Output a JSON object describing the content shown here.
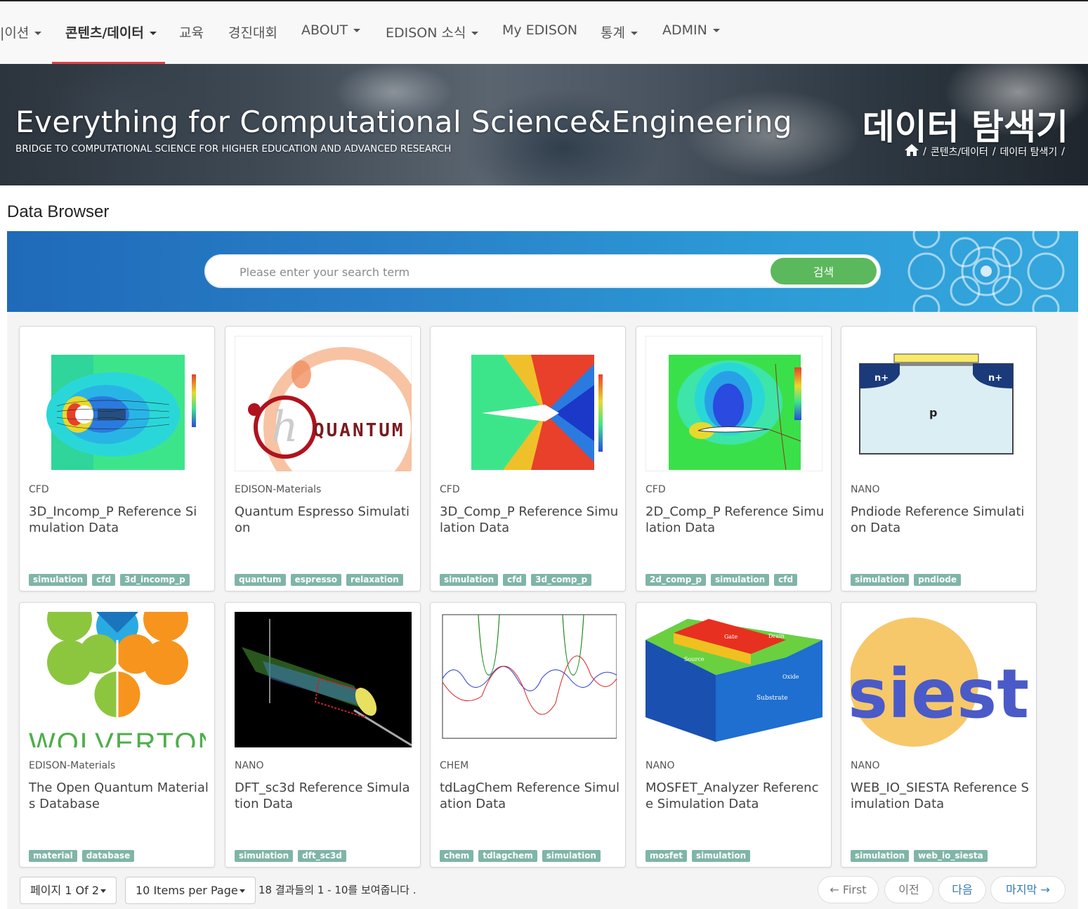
{
  "nav": {
    "items": [
      {
        "label": "|이션",
        "caret": true
      },
      {
        "label": "콘텐츠/데이터",
        "caret": true
      },
      {
        "label": "교육",
        "caret": false
      },
      {
        "label": "경진대회",
        "caret": false
      },
      {
        "label": "ABOUT",
        "caret": true
      },
      {
        "label": "EDISON 소식",
        "caret": true
      },
      {
        "label": "My EDISON",
        "caret": false
      },
      {
        "label": "통계",
        "caret": true
      },
      {
        "label": "ADMIN",
        "caret": true
      }
    ],
    "active_index": 1
  },
  "banner": {
    "title": "Everything for Computational Science&Engineering",
    "subtitle": "BRIDGE TO COMPUTATIONAL SCIENCE FOR HIGHER EDUCATION AND ADVANCED RESEARCH",
    "page_title": "데이터 탐색기",
    "breadcrumb": [
      "/",
      "콘텐츠/데이터",
      "/",
      "데이터 탐색기",
      "/"
    ]
  },
  "section_title": "Data Browser",
  "search": {
    "placeholder": "Please enter your search term",
    "button_label": "검색"
  },
  "cards": [
    {
      "category": "CFD",
      "title": "3D_Incomp_P Reference Simulation Data",
      "tags": [
        "simulation",
        "cfd",
        "3d_incomp_p"
      ],
      "thumb": "cfd-incompressible-cylinder-contour"
    },
    {
      "category": "EDISON-Materials",
      "title": "Quantum Espresso Simulation",
      "tags": [
        "quantum",
        "espresso",
        "relaxation"
      ],
      "thumb": "quantum-espresso-logo"
    },
    {
      "category": "CFD",
      "title": "3D_Comp_P Reference Simulation Data",
      "tags": [
        "simulation",
        "cfd",
        "3d_comp_p"
      ],
      "thumb": "cfd-compressible-wedge-contour"
    },
    {
      "category": "CFD",
      "title": "2D_Comp_P Reference Simulation Data",
      "tags": [
        "2d_comp_p",
        "simulation",
        "cfd"
      ],
      "thumb": "cfd-airfoil-contour"
    },
    {
      "category": "NANO",
      "title": "Pndiode Reference Simulation Data",
      "tags": [
        "simulation",
        "pndiode"
      ],
      "thumb": "pn-diode-diagram"
    },
    {
      "category": "EDISON-Materials",
      "title": "The Open Quantum Materials Database",
      "tags": [
        "material",
        "database"
      ],
      "thumb": "wolverton-logo"
    },
    {
      "category": "NANO",
      "title": "DFT_sc3d Reference Simulation Data",
      "tags": [
        "simulation",
        "dft_sc3d"
      ],
      "thumb": "nanotube-render"
    },
    {
      "category": "CHEM",
      "title": "tdLagChem Reference Simulation Data",
      "tags": [
        "chem",
        "tdlagchem",
        "simulation"
      ],
      "thumb": "wavefunction-plot"
    },
    {
      "category": "NANO",
      "title": "MOSFET_Analyzer Reference Simulation Data",
      "tags": [
        "mosfet",
        "simulation"
      ],
      "thumb": "mosfet-3d-diagram"
    },
    {
      "category": "NANO",
      "title": "WEB_IO_SIESTA Reference Simulation Data",
      "tags": [
        "simulation",
        "web_io_siesta"
      ],
      "thumb": "siesta-logo"
    }
  ],
  "thumb_text": {
    "quantum": "QUANTUM",
    "wolverton": "WOLVERTON",
    "siesta": "siesta",
    "pn_nplus": "n+",
    "pn_p": "p",
    "gate": "Gate",
    "drain": "Drain",
    "source": "Source",
    "oxide": "Oxide",
    "substrate": "Substrate"
  },
  "pagination": {
    "page_select": "페이지 1 Of 2",
    "per_page_select": "10 Items per Page",
    "info": "18 결과들의 1 - 10를 보여줍니다 .",
    "first": "← First",
    "prev": "이전",
    "next": "다음",
    "last": "마지막 →"
  },
  "colors": {
    "nav_active_underline": "#e0424a",
    "search_button": "#5cb85c",
    "tag": "#7fb5a8",
    "link": "#337ab7"
  }
}
